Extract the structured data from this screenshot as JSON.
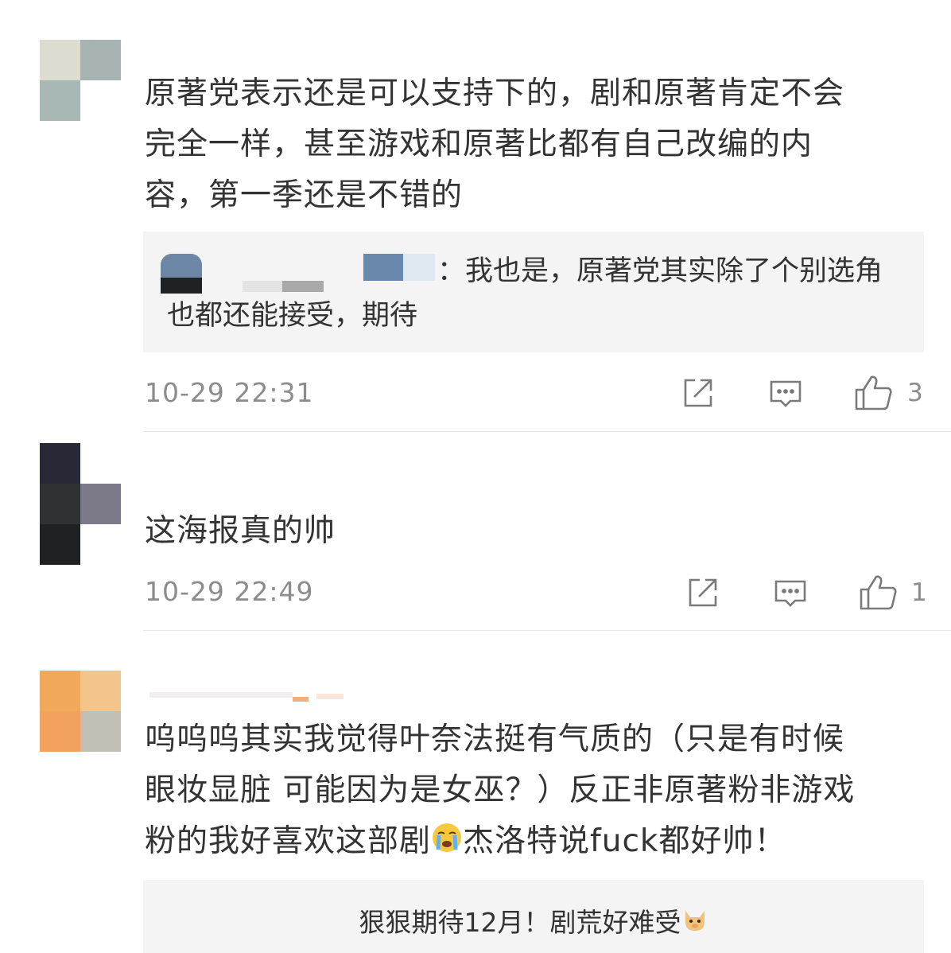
{
  "comments": [
    {
      "id": "c1",
      "avatar_colors": [
        "#dcdcd0",
        "#a7b4b1",
        "#a8b8b5",
        "#ffffff"
      ],
      "text_lines": [
        "原著党表示还是可以支持下的，剧和原著肯定不会",
        "完全一样，甚至游戏和原著比都有自己改编的内",
        "容，第一季还是不错的"
      ],
      "reply": {
        "text_line1": "：我也是，原著党其实除了个别选角",
        "text_line2": "也都还能接受，期待"
      },
      "time": "10-29 22:31",
      "likes": "3"
    },
    {
      "id": "c2",
      "avatar_colors": [
        "#282936",
        "#2f3134",
        "#202122",
        "#7c7a88"
      ],
      "text_lines": [
        "这海报真的帅"
      ],
      "time": "10-29 22:49",
      "likes": "1"
    },
    {
      "id": "c3",
      "avatar_colors": [
        "#f0a85a",
        "#f3c48c",
        "#f2a15e",
        "#bfbfb4"
      ],
      "text_lines": [
        "呜呜呜其实我觉得叶奈法挺有气质的（只是有时候",
        "眼妆显脏 可能因为是女巫？）反正非原著粉非游戏",
        "粉的我好喜欢这部剧",
        "杰洛特说fuck都好帅！"
      ],
      "reply_preview": "狠狠期待12月！剧荒好难受"
    }
  ],
  "icons": {
    "share": "share-icon",
    "comment": "comment-icon",
    "like": "thumbs-up-icon",
    "crying": "crying-emoji",
    "dog": "dog-emoji"
  }
}
